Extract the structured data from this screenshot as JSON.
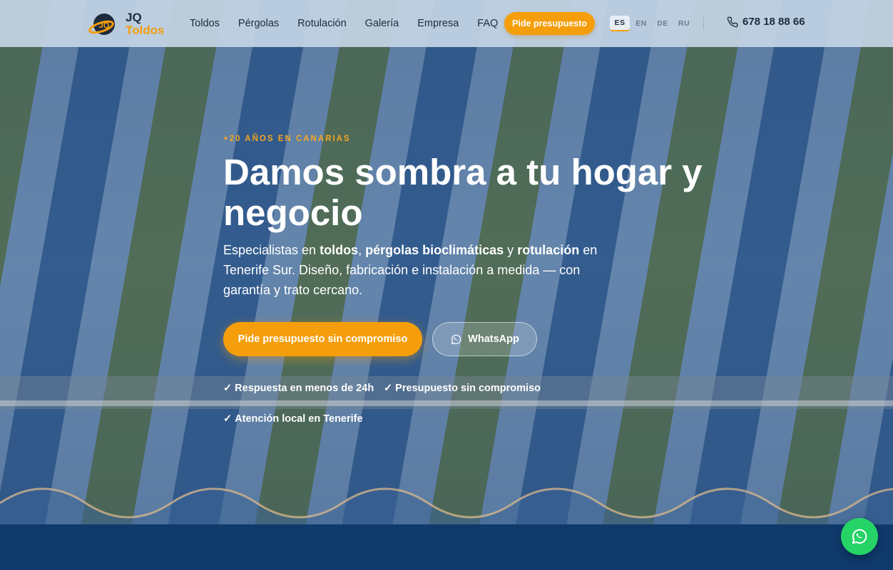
{
  "header": {
    "logo": {
      "line1": "JQ",
      "line2": "Toldos"
    },
    "nav": [
      {
        "label": "Toldos"
      },
      {
        "label": "Pérgolas"
      },
      {
        "label": "Rotulación"
      },
      {
        "label": "Galería"
      },
      {
        "label": "Empresa"
      },
      {
        "label": "FAQ"
      }
    ],
    "quote_button": "Pide presupuesto",
    "languages": [
      {
        "code": "ES",
        "active": true
      },
      {
        "code": "EN",
        "active": false
      },
      {
        "code": "DE",
        "active": false
      },
      {
        "code": "RU",
        "active": false
      }
    ],
    "phone": "678 18 88 66"
  },
  "hero": {
    "eyebrow": "+20 AÑOS EN CANARIAS",
    "title": "Damos sombra a tu hogar y negocio",
    "subtitle": {
      "p1": "Especialistas en ",
      "b1": "toldos",
      "p2": ", ",
      "b2": "pérgolas bioclimáticas",
      "p3": " y ",
      "b3": "rotulación",
      "p4": " en Tenerife Sur. Diseño, fabricación e instalación a medida — con garantía y trato cercano."
    },
    "cta_primary": "Pide presupuesto sin compromiso",
    "cta_whatsapp": "WhatsApp",
    "checks": [
      "Respuesta en menos de 24h",
      "Presupuesto sin compromiso",
      "Atención local en Tenerife"
    ],
    "check_glyph": "✓"
  },
  "colors": {
    "accent": "#f59e0b",
    "header_bg": "#c4d4e4",
    "text_dark": "#1e2b3c",
    "whatsapp": "#25d366",
    "footer_band": "#0f3a6b"
  },
  "icons": {
    "phone": "phone-icon",
    "whatsapp": "whatsapp-icon",
    "logo": "logo-mark-icon"
  }
}
